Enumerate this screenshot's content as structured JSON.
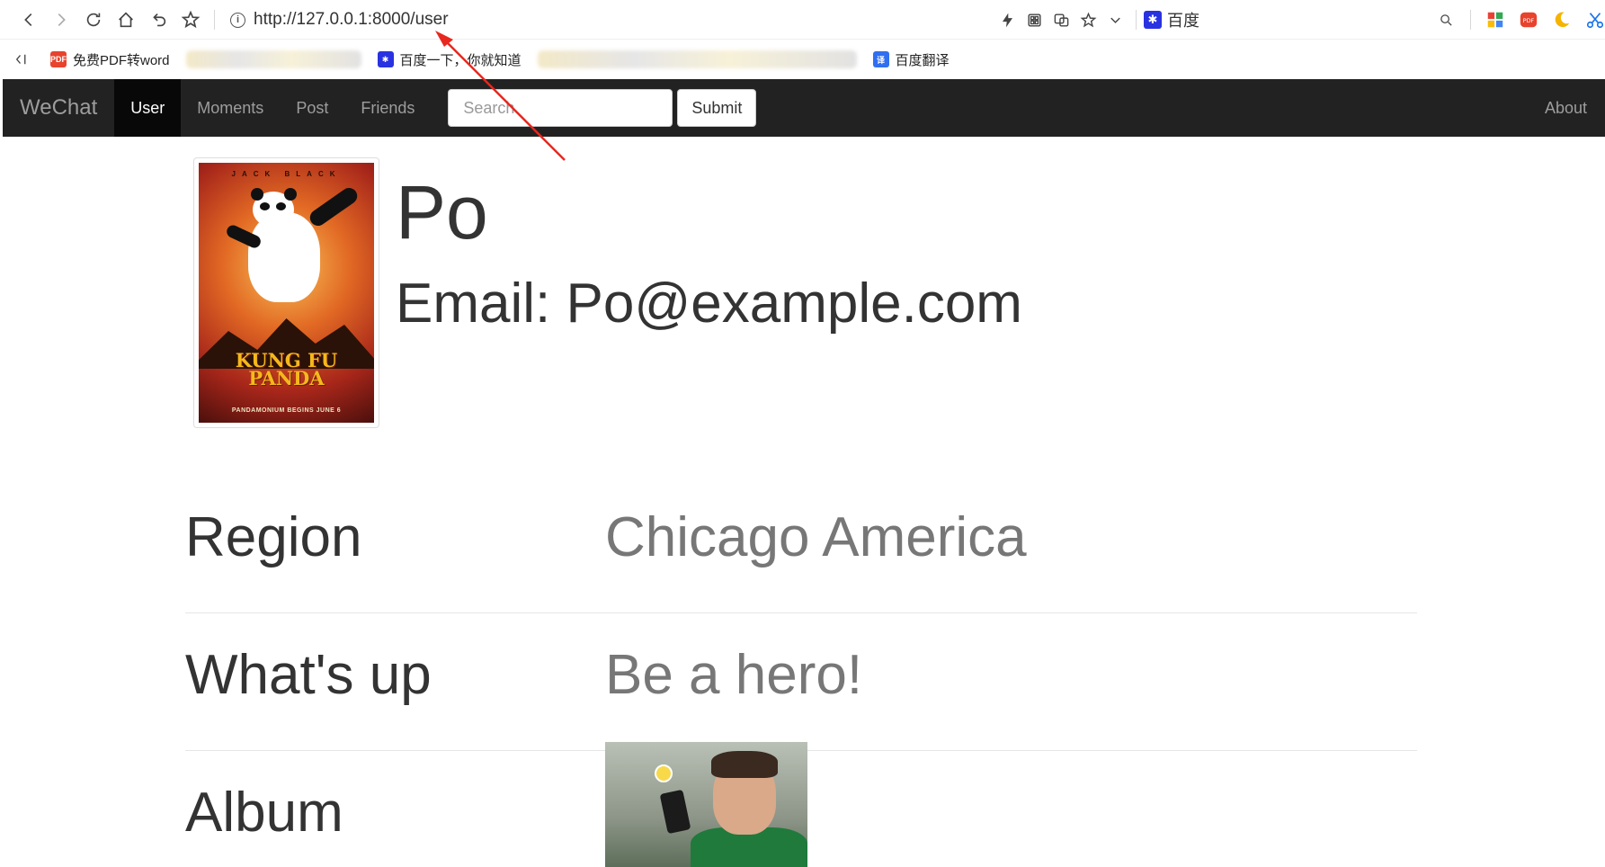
{
  "browser": {
    "url": "http://127.0.0.1:8000/user",
    "baidu_label": "百度",
    "bookmarks": [
      {
        "label": "免费PDF转word"
      },
      {
        "label": "百度一下，你就知道"
      },
      {
        "label": "百度翻译"
      }
    ]
  },
  "navbar": {
    "brand": "WeChat",
    "items": [
      {
        "label": "User",
        "active": true
      },
      {
        "label": "Moments"
      },
      {
        "label": "Post"
      },
      {
        "label": "Friends"
      }
    ],
    "search_placeholder": "Search",
    "submit_label": "Submit",
    "about_label": "About"
  },
  "profile": {
    "name": "Po",
    "email_text": "Email: Po@example.com",
    "poster": {
      "top_text": "JACK BLACK",
      "title_line1": "KUNG FU",
      "title_line2": "PANDA",
      "tagline": "PANDAMONIUM BEGINS JUNE 6"
    },
    "rows": [
      {
        "label": "Region",
        "value": "Chicago America"
      },
      {
        "label": "What's up",
        "value": "Be a hero!"
      },
      {
        "label": "Album",
        "value": ""
      }
    ]
  },
  "colors": {
    "navbar_bg": "#222222",
    "navbar_active": "#080808",
    "annotation_arrow": "#e8271f"
  }
}
